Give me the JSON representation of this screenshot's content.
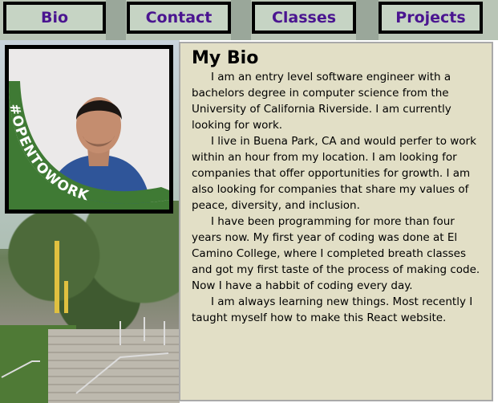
{
  "nav": {
    "items": [
      {
        "label": "Bio"
      },
      {
        "label": "Contact"
      },
      {
        "label": "Classes"
      },
      {
        "label": "Projects"
      }
    ]
  },
  "profile": {
    "badge_text": "#OPENTOWORK",
    "badge_color": "#3f7a34"
  },
  "bio": {
    "title": "My Bio",
    "paragraphs": [
      "I am an entry level software engineer with a bachelors degree in computer science from the University of California Riverside. I am currently looking for work.",
      "I live in Buena Park, CA and would perfer to work within an hour from my location. I am looking for companies that offer opportunities for growth. I am also looking for companies that share my values of peace, diversity, and inclusion.",
      "I have been programming for more than four years now. My first year of coding was done at El Camino College, where I completed breath classes and got my first taste of the process of making code. Now I have a habbit of coding every day.",
      "I am always learning new things. Most recently I taught myself how to make this React website."
    ]
  },
  "colors": {
    "nav_text": "#4a1590",
    "nav_button_bg": "#c6d4c4",
    "panel_bg": "#e2dfc6"
  }
}
